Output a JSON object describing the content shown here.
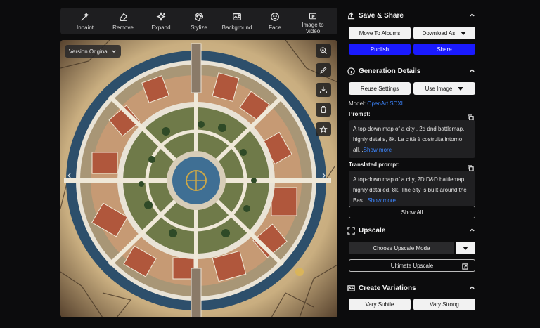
{
  "toolbar": {
    "tools": [
      {
        "label": "Inpaint",
        "icon": "inpaint-icon"
      },
      {
        "label": "Remove",
        "icon": "eraser-icon"
      },
      {
        "label": "Expand",
        "icon": "expand-sparkle-icon"
      },
      {
        "label": "Stylize",
        "icon": "palette-icon"
      },
      {
        "label": "Background",
        "icon": "background-image-icon"
      },
      {
        "label": "Face",
        "icon": "face-icon"
      },
      {
        "label": "Image to\nVideo",
        "icon": "video-icon"
      }
    ]
  },
  "image": {
    "version_label": "Version Original",
    "side_tools": [
      "zoom-in-icon",
      "edit-pencil-icon",
      "download-icon",
      "trash-icon",
      "star-icon"
    ]
  },
  "save_share": {
    "title": "Save & Share",
    "move_to_albums": "Move To Albums",
    "download_as": "Download As",
    "publish": "Publish",
    "share": "Share"
  },
  "generation": {
    "title": "Generation Details",
    "reuse_settings": "Reuse Settings",
    "use_image": "Use Image",
    "model_label": "Model:",
    "model_value": "OpenArt SDXL",
    "prompt_label": "Prompt:",
    "prompt_text": "A top-down map of a city , 2d dnd battlemap, highly details, 8k. La città è costruita intorno all...",
    "prompt_more": "Show more",
    "translated_label": "Translated prompt:",
    "translated_text": "A top-down map of a city, 2D D&D battlemap, highly detailed, 8k. The city is built around the Bas...",
    "translated_more": "Show more",
    "show_all": "Show All"
  },
  "upscale": {
    "title": "Upscale",
    "mode": "Choose Upscale Mode",
    "ultimate": "Ultimate Upscale"
  },
  "variations": {
    "title": "Create Variations",
    "subtle": "Vary Subtle",
    "strong": "Vary Strong"
  },
  "colors": {
    "accent_blue": "#1a1aff",
    "link_blue": "#3d86ff",
    "background": "#0c0c0d"
  }
}
